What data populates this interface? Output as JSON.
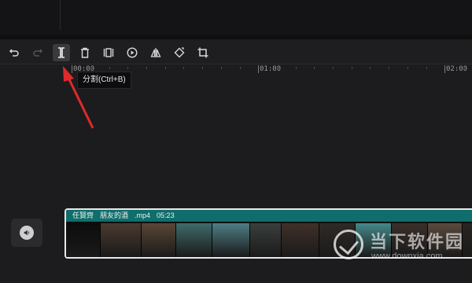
{
  "toolbar": {
    "tools": [
      {
        "name": "undo-icon"
      },
      {
        "name": "redo-icon"
      },
      {
        "name": "split-icon"
      },
      {
        "name": "delete-icon"
      },
      {
        "name": "freeze-frame-icon"
      },
      {
        "name": "reverse-icon"
      },
      {
        "name": "mirror-icon"
      },
      {
        "name": "rotate-icon"
      },
      {
        "name": "crop-icon"
      }
    ]
  },
  "tooltip": {
    "text": "分割(Ctrl+B)"
  },
  "ruler": {
    "labels": [
      "00:00",
      "01:00",
      "02:00"
    ]
  },
  "clip": {
    "artist": "任賢齊",
    "title": "朋友的酒",
    "ext": ".mp4",
    "duration": "05:23"
  },
  "watermark": {
    "cn": "当下软件园",
    "url": "www.downxia.com"
  },
  "colors": {
    "accent": "#0f6e6b",
    "arrow": "#e02a2a",
    "background": "#1c1c1e"
  }
}
